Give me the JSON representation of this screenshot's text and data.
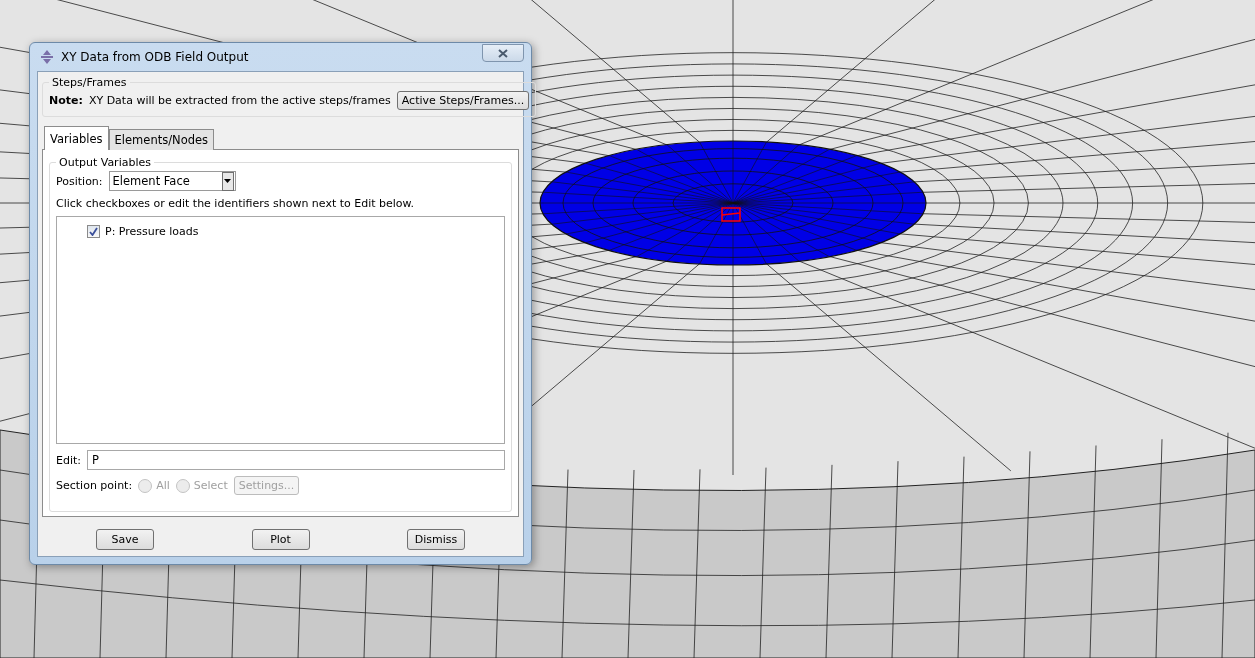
{
  "dialog": {
    "title": "XY Data from ODB Field Output"
  },
  "steps_frames": {
    "legend": "Steps/Frames",
    "note_label": "Note:",
    "note": "XY Data will be extracted from the active steps/frames",
    "button": "Active Steps/Frames..."
  },
  "tabs": [
    {
      "label": "Variables",
      "selected": true
    },
    {
      "label": "Elements/Nodes",
      "selected": false
    }
  ],
  "output_variables": {
    "legend": "Output Variables",
    "position_label": "Position:",
    "position_value": "Element Face",
    "instruction": "Click checkboxes or edit the identifiers shown next to Edit below.",
    "items": [
      {
        "label": "P: Pressure loads",
        "checked": true
      }
    ],
    "edit_label": "Edit:",
    "edit_value": "P",
    "section_point_label": "Section point:",
    "section_options": [
      {
        "label": "All",
        "selected": false,
        "disabled": true
      },
      {
        "label": "Select",
        "selected": false,
        "disabled": true
      }
    ],
    "settings_button": {
      "label": "Settings...",
      "disabled": true
    }
  },
  "buttons": [
    "Save",
    "Plot",
    "Dismiss"
  ]
}
